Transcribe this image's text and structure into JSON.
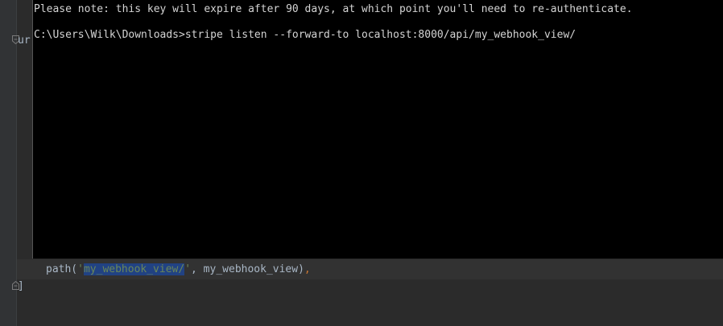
{
  "editor": {
    "left_fragment": "ur",
    "closing_bracket": "]",
    "path_call": {
      "prefix": "path(",
      "quote_open": "'",
      "selected_arg": "my_webhook_view/",
      "quote_close": "'",
      "middle": ", my_webhook_view)",
      "trailing_comma": ","
    }
  },
  "terminal": {
    "lines": [
      "Please note: this key will expire after 90 days, at which point you'll need to re-authenticate.",
      "C:\\Users\\Wilk\\Downloads>stripe listen --forward-to localhost:8000/api/my_webhook_view/"
    ]
  },
  "colors": {
    "editor_bg": "#2b2b2b",
    "terminal_bg": "#000000",
    "selection_bg": "#214283",
    "string_color": "#6a8759",
    "keyword_color": "#cc7832"
  }
}
